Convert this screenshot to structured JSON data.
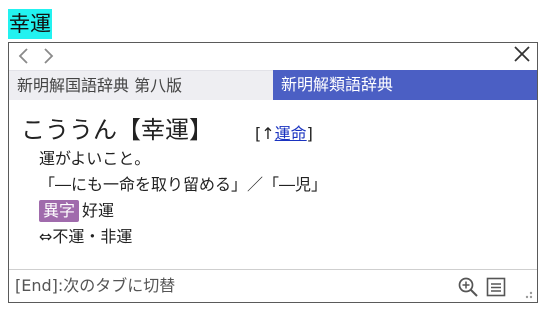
{
  "selection": {
    "text": "幸運"
  },
  "popup": {
    "nav": {
      "back_icon": "chevron-left-icon",
      "forward_icon": "chevron-right-icon",
      "close_icon": "close-icon"
    },
    "tabs": [
      {
        "label": "新明解国語辞典 第八版",
        "active": false
      },
      {
        "label": "新明解類語辞典",
        "active": true
      }
    ],
    "entry": {
      "headword": "こううん【幸運】",
      "xref_prefix": "[↑",
      "xref_link": "運命",
      "xref_suffix": "]",
      "definition": "運がよいこと。",
      "example": "「―にも一命を取り留める」／「―児」",
      "badge": "異字",
      "variant": "好運",
      "antonym": "⇔不運・非運"
    },
    "status": {
      "hint": "[End]:次のタブに切替",
      "icons": [
        "zoom-in-icon",
        "list-icon",
        "resize-grip-icon"
      ]
    }
  },
  "colors": {
    "selection_highlight": "#22f2f0",
    "active_tab": "#4b5fc4",
    "badge": "#a06bac",
    "link": "#1a33c0"
  }
}
